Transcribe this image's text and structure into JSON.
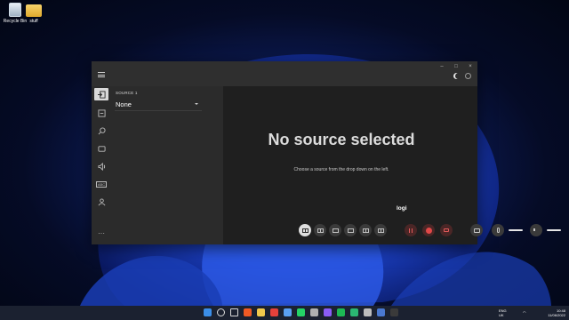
{
  "desktop": {
    "icons": [
      {
        "label": "Recycle Bin",
        "icon": "recycle-bin-icon"
      },
      {
        "label": "stuff",
        "icon": "folder-icon"
      }
    ]
  },
  "window": {
    "controls": {
      "minimize": "–",
      "maximize": "□",
      "close": "×"
    },
    "theme_icon": "moon-icon",
    "rail": [
      {
        "name": "source-input-icon",
        "active": true
      },
      {
        "name": "source-output-icon",
        "active": false
      },
      {
        "name": "zoom-icon",
        "active": false
      },
      {
        "name": "camera-icon",
        "active": false
      },
      {
        "name": "audio-icon",
        "active": false
      },
      {
        "name": "text-icon",
        "active": false,
        "label": "ABC"
      },
      {
        "name": "user-icon",
        "active": false
      },
      {
        "name": "more-icon",
        "active": false,
        "label": "···"
      }
    ],
    "source": {
      "label": "SOURCE 1",
      "value": "None"
    },
    "preview": {
      "headline": "No source selected",
      "subline": "Choose a source from the drop down on the left.",
      "logo": "logi"
    },
    "toolbar": {
      "layouts": 6,
      "selected_layout": 0
    }
  },
  "taskbar": {
    "language": "ENG",
    "region": "UK",
    "time": "10:48",
    "date": "11/06/2022",
    "apps": [
      {
        "name": "start-icon",
        "color": "#3b8ee8"
      },
      {
        "name": "search-icon",
        "color": "#d8d8d8"
      },
      {
        "name": "task-view-icon",
        "color": "#d8d8d8"
      },
      {
        "name": "brave-icon",
        "color": "#f05a24"
      },
      {
        "name": "pin-icon",
        "color": "#f2c94c"
      },
      {
        "name": "vivaldi-icon",
        "color": "#e5413b"
      },
      {
        "name": "app-icon",
        "color": "#5aa0f2"
      },
      {
        "name": "whatsapp-icon",
        "color": "#25d366"
      },
      {
        "name": "settings-icon",
        "color": "#b0b0b0"
      },
      {
        "name": "app2-icon",
        "color": "#8a5cf6"
      },
      {
        "name": "spotify-icon",
        "color": "#1db954"
      },
      {
        "name": "app3-icon",
        "color": "#2bb673"
      },
      {
        "name": "app4-icon",
        "color": "#bdbdbd"
      },
      {
        "name": "app5-icon",
        "color": "#4a78d0"
      },
      {
        "name": "app6-icon",
        "color": "#3a3a3a"
      }
    ]
  }
}
